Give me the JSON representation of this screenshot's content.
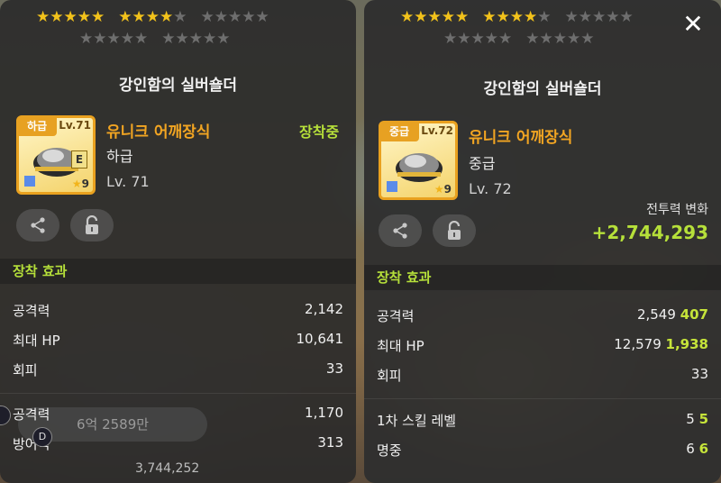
{
  "left_panel": {
    "stars": {
      "row1": [
        5,
        4,
        0
      ],
      "row2": [
        0,
        0
      ]
    },
    "title": "강인함의 실버숄더",
    "item": {
      "grade_tag": "하급",
      "level_tag": "Lv.71",
      "e_badge": "E",
      "star_count": "9",
      "type": "유니크 어깨장식",
      "grade": "하급",
      "level": "Lv. 71",
      "status": "장착중"
    },
    "section_title": "장착 효과",
    "stats": [
      {
        "label": "공격력",
        "value": "2,142"
      },
      {
        "label": "최대 HP",
        "value": "10,641"
      },
      {
        "label": "회피",
        "value": "33"
      }
    ],
    "extra_stats": [
      {
        "label": "공격력",
        "value": "1,170"
      },
      {
        "label": "방어력",
        "value": "313"
      }
    ],
    "mesos_text": "6억 2589만",
    "bottom_number": "3,744,252",
    "side_badge": "D"
  },
  "right_panel": {
    "stars": {
      "row1": [
        5,
        4,
        0
      ],
      "row2": [
        0,
        0
      ]
    },
    "close": "✕",
    "title": "강인함의 실버숄더",
    "item": {
      "grade_tag": "중급",
      "level_tag": "Lv.72",
      "star_count": "9",
      "type": "유니크 어깨장식",
      "grade": "중급",
      "level": "Lv. 72"
    },
    "cp_label": "전투력 변화",
    "cp_value": "+2,744,293",
    "section_title": "장착 효과",
    "stats": [
      {
        "label": "공격력",
        "value": "2,549",
        "bonus": "407"
      },
      {
        "label": "최대 HP",
        "value": "12,579",
        "bonus": "1,938"
      },
      {
        "label": "회피",
        "value": "33",
        "bonus": ""
      }
    ],
    "extra_stats": [
      {
        "label": "1차 스킬 레벨",
        "value": "5",
        "bonus": "5"
      },
      {
        "label": "명중",
        "value": "6",
        "bonus": "6"
      }
    ]
  },
  "colors": {
    "star_on": "#f2c21b",
    "star_off": "#6e6e6e",
    "accent_green": "#b6e03a",
    "item_type_orange": "#f2a522"
  },
  "icons": [
    "share-icon",
    "lock-icon",
    "close-icon"
  ]
}
